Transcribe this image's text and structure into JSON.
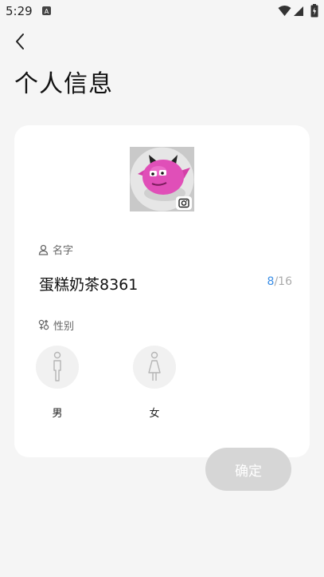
{
  "status_bar": {
    "time": "5:29",
    "notification": "A"
  },
  "page": {
    "title": "个人信息"
  },
  "profile": {
    "name_label": "名字",
    "name_value": "蛋糕奶茶8361",
    "name_count": "8",
    "name_max": "/16",
    "gender_label": "性别",
    "gender_options": [
      "男",
      "女"
    ]
  },
  "actions": {
    "confirm_label": "确定"
  },
  "colors": {
    "accent": "#3a8ee6",
    "avatar_pink": "#e04fb8",
    "button_disabled": "#d6d6d6"
  }
}
